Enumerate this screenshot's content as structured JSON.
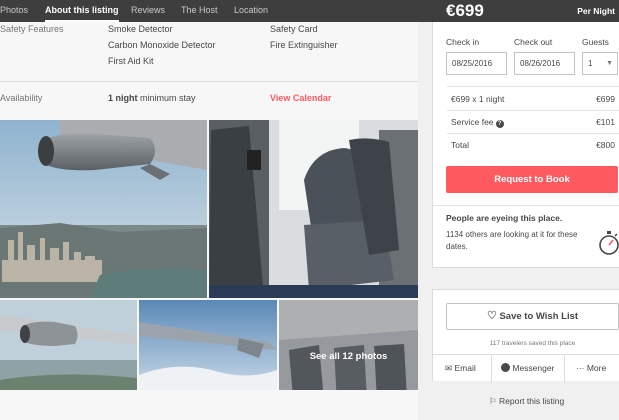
{
  "nav": {
    "tabs": [
      {
        "label": "Photos"
      },
      {
        "label": "About this listing"
      },
      {
        "label": "Reviews"
      },
      {
        "label": "The Host"
      },
      {
        "label": "Location"
      }
    ]
  },
  "details": {
    "safety_label": "Safety Features",
    "safety_items": [
      "Smoke Detector",
      "Carbon Monoxide Detector",
      "First Aid Kit",
      "Safety Card",
      "Fire Extinguisher"
    ],
    "availability_label": "Availability",
    "min_stay_bold": "1 night",
    "min_stay_rest": " minimum stay",
    "view_calendar": "View Calendar"
  },
  "photos": {
    "see_all": "See all 12 photos"
  },
  "booking": {
    "price": "€699",
    "per_night": "Per Night",
    "checkin_label": "Check in",
    "checkout_label": "Check out",
    "guests_label": "Guests",
    "checkin_value": "08/25/2016",
    "checkout_value": "08/26/2016",
    "guests_value": "1",
    "line_item_label": "€699 x 1 night",
    "line_item_amount": "€699",
    "service_fee_label": "Service fee",
    "service_fee_amount": "€101",
    "total_label": "Total",
    "total_amount": "€800",
    "book_button": "Request to Book",
    "eyeing_title": "People are eyeing this place.",
    "eyeing_text": "1134 others are looking at it for these dates.",
    "accent_color": "#ff5a5f"
  },
  "wishlist": {
    "button": "Save to Wish List",
    "note": "117 travelers saved this place",
    "email": "Email",
    "messenger": "Messenger",
    "more": "··· More"
  },
  "report": "Report this listing"
}
